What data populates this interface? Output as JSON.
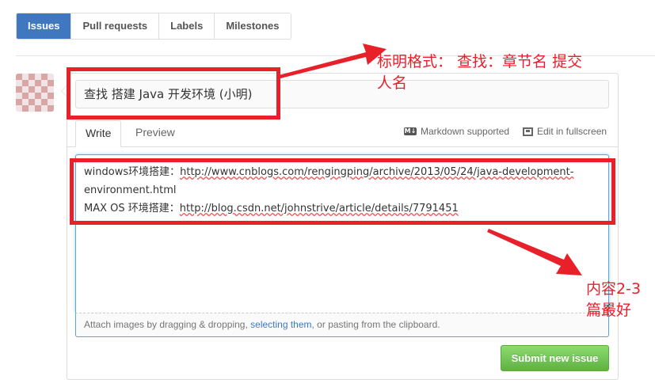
{
  "nav": {
    "tabs": [
      {
        "label": "Issues"
      },
      {
        "label": "Pull requests"
      },
      {
        "label": "Labels"
      },
      {
        "label": "Milestones"
      }
    ],
    "selected_color": "#4078c0"
  },
  "form": {
    "title_value": "查找 搭建 Java 开发环境 (小明)",
    "write_tab": "Write",
    "preview_tab": "Preview",
    "markdown_label": "Markdown supported",
    "markdown_icon_text": "M↓",
    "fullscreen_label": "Edit in fullscreen",
    "body_lines": [
      {
        "prefix": "windows环境搭建：",
        "url": "http://www.cnblogs.com/rengingping/archive/2013/05/24/java-development-"
      },
      {
        "prefix": "",
        "url": "environment.html"
      },
      {
        "prefix": "MAX OS 环境搭建：",
        "url": "http://blog.csdn.net/johnstrive/article/details/7791451"
      }
    ],
    "attach": {
      "before": "Attach images by dragging & dropping, ",
      "link": "selecting them",
      "after": ", or pasting from the clipboard."
    },
    "submit_label": "Submit new issue"
  },
  "annotations": {
    "title_note_line1": "标明格式： 查找：章节名 提交",
    "title_note_line2": "人名",
    "body_note_line1": "内容2-3",
    "body_note_line2": "篇最好",
    "color": "#e8202a"
  }
}
